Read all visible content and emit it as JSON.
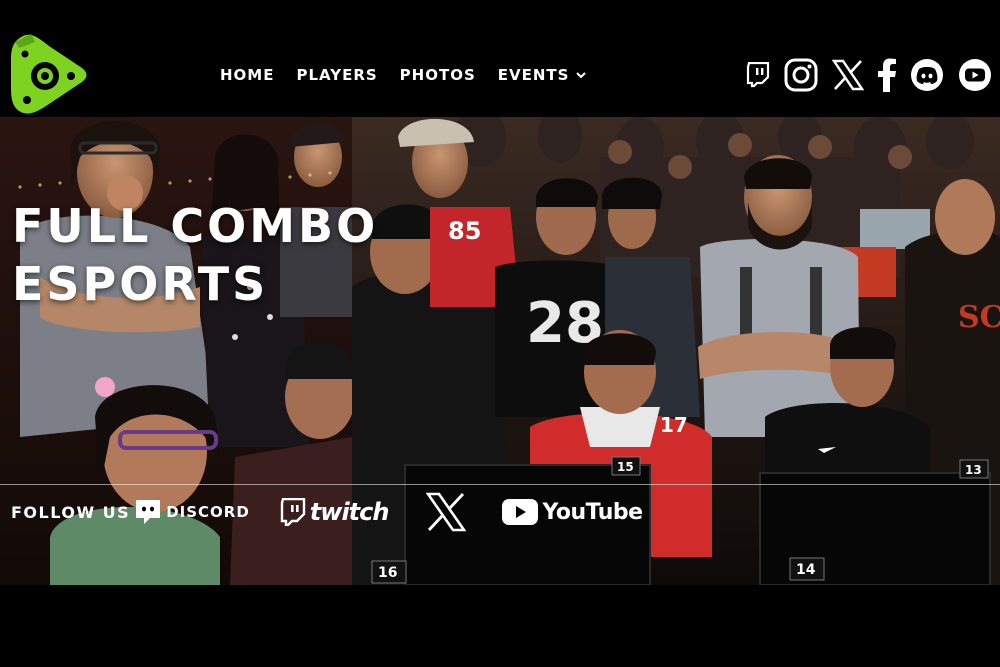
{
  "brand": {
    "accent_color": "#7ed321",
    "logo_icon": "play-gamepad-logo-icon"
  },
  "nav": {
    "items": [
      {
        "label": "HOME"
      },
      {
        "label": "PLAYERS"
      },
      {
        "label": "PHOTOS"
      },
      {
        "label": "EVENTS",
        "icon": "chevron-down-icon"
      }
    ]
  },
  "header_social": [
    "twitch-icon",
    "instagram-icon",
    "x-icon",
    "facebook-icon",
    "discord-icon",
    "youtube-icon"
  ],
  "hero": {
    "title_line1": "FULL COMBO",
    "title_line2": "ESPORTS",
    "station_numbers": [
      "15",
      "16",
      "13",
      "14"
    ],
    "jersey_numbers": [
      "85",
      "28",
      "17"
    ]
  },
  "follow": {
    "label": "FOLLOW US",
    "links": {
      "discord": "DISCORD",
      "twitch": "twitch",
      "youtube": "YouTube"
    }
  }
}
